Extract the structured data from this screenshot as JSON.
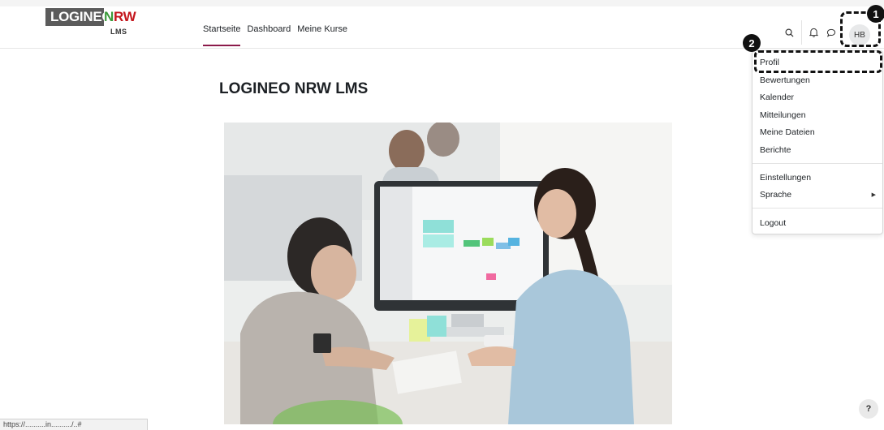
{
  "logo": {
    "part1": "LOGINEO",
    "part2_n": "N",
    "part2_rw": "RW",
    "sub": "LMS"
  },
  "nav": {
    "items": [
      "Startseite",
      "Dashboard",
      "Meine Kurse"
    ],
    "active": "Startseite"
  },
  "header_icons": [
    "search-icon",
    "bell-icon",
    "chat-icon"
  ],
  "avatar_initials": "HB",
  "callouts": [
    "1",
    "2"
  ],
  "page_title": "LOGINEO NRW LMS",
  "user_menu": {
    "group1": [
      "Profil",
      "Bewertungen",
      "Kalender",
      "Mitteilungen",
      "Meine Dateien",
      "Berichte"
    ],
    "group2": [
      "Einstellungen",
      "Sprache"
    ],
    "group3": [
      "Logout"
    ]
  },
  "help_label": "?",
  "status_url": "https://..........in........../..#"
}
